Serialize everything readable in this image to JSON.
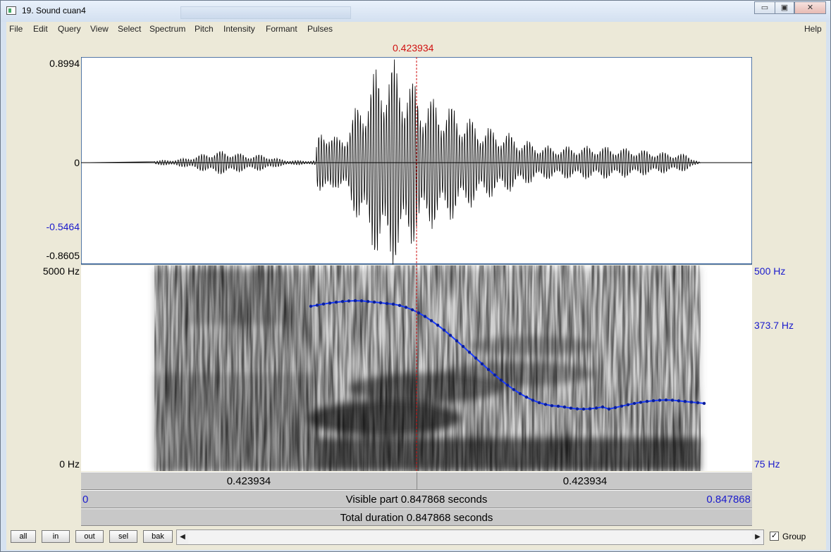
{
  "window": {
    "title": "19. Sound cuan4",
    "controls": {
      "minimize": "▭",
      "maximize": "▣",
      "close": "✕"
    }
  },
  "menu": {
    "items": [
      "File",
      "Edit",
      "Query",
      "View",
      "Select",
      "Spectrum",
      "Pitch",
      "Intensity",
      "Formant",
      "Pulses"
    ],
    "help": "Help"
  },
  "cursor": {
    "time_label": "0.423934"
  },
  "waveform": {
    "labels": {
      "max": "0.8994",
      "zero": "0",
      "marker": "-0.5464",
      "min": "-0.8605"
    }
  },
  "spectrogram": {
    "labels": {
      "top_freq": "5000 Hz",
      "bottom_freq": "0 Hz"
    },
    "pitch_labels": {
      "top": "500 Hz",
      "marker": "373.7 Hz",
      "bottom": "75 Hz"
    }
  },
  "time_bars": {
    "left_segment": "0.423934",
    "right_segment": "0.423934",
    "visible_start": "0",
    "visible_label": "Visible part 0.847868 seconds",
    "visible_end": "0.847868",
    "total_label": "Total duration 0.847868 seconds"
  },
  "bottom": {
    "buttons": [
      "all",
      "in",
      "out",
      "sel",
      "bak"
    ],
    "scroll_left": "◀",
    "scroll_right": "▶",
    "group_label": "Group",
    "group_checked": true,
    "check_mark": "✓"
  },
  "colors": {
    "cursor": "#d01010",
    "pitch": "#1a3cff",
    "axis_blue": "#1a1acc"
  }
}
